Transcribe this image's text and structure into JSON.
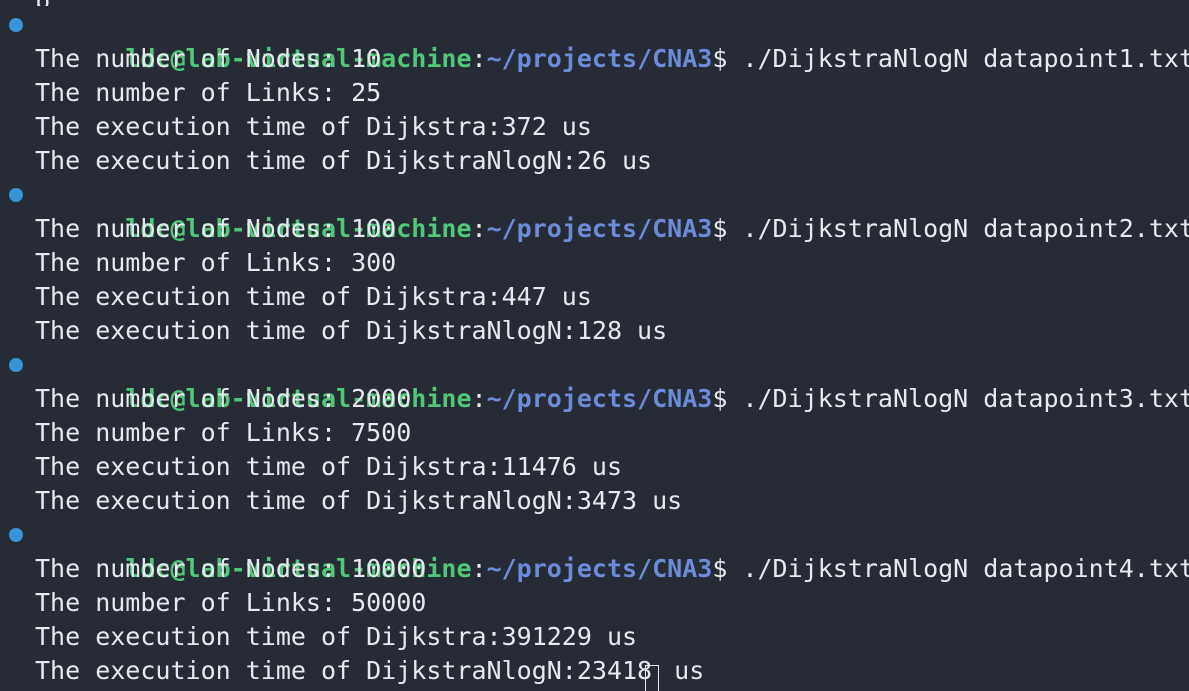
{
  "terminal": {
    "prompt_user": "ldc@lab-virtual-machine",
    "prompt_colon": ":",
    "prompt_path": "~/projects/CNA3",
    "prompt_symbol": "$",
    "top_remnant": "p",
    "marker_color": "#3794d8",
    "user_color": "#50c878",
    "path_color": "#6c8bd8",
    "background_color": "#262b36",
    "sessions": [
      {
        "command": " ./DijkstraNlogN datapoint1.txt",
        "output": [
          "The number of Nodes: 10",
          "The number of Links: 25",
          "The execution time of Dijkstra:372 us",
          "The execution time of DijkstraNlogN:26 us"
        ]
      },
      {
        "command": " ./DijkstraNlogN datapoint2.txt",
        "output": [
          "The number of Nodes: 100",
          "The number of Links: 300",
          "The execution time of Dijkstra:447 us",
          "The execution time of DijkstraNlogN:128 us"
        ]
      },
      {
        "command": " ./DijkstraNlogN datapoint3.txt",
        "output": [
          "The number of Nodes: 2000",
          "The number of Links: 7500",
          "The execution time of Dijkstra:11476 us",
          "The execution time of DijkstraNlogN:3473 us"
        ]
      },
      {
        "command": " ./DijkstraNlogN datapoint4.txt",
        "output": [
          "The number of Nodes: 10000",
          "The number of Links: 50000",
          "The execution time of Dijkstra:391229 us",
          "The execution time of DijkstraNlogN:23418",
          " us"
        ]
      }
    ]
  }
}
